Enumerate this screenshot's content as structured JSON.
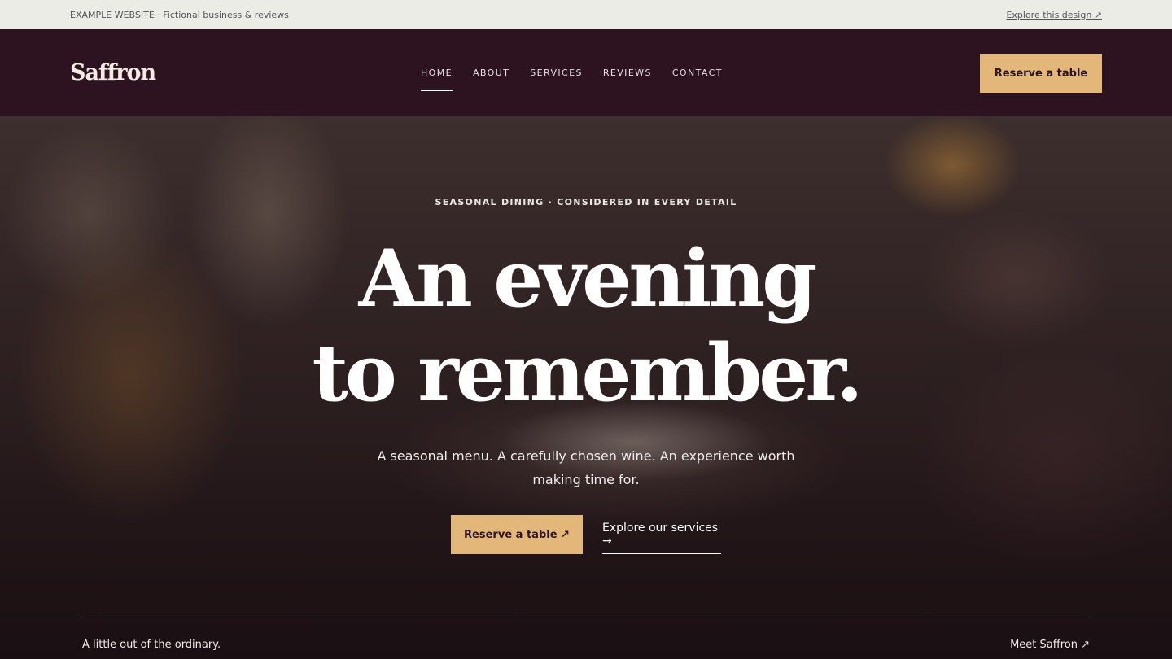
{
  "topbar": {
    "label": "EXAMPLE WEBSITE · Fictional business & reviews",
    "link": "Explore this design ↗"
  },
  "header": {
    "logo": "Saffron",
    "nav": [
      "HOME",
      "ABOUT",
      "SERVICES",
      "REVIEWS",
      "CONTACT"
    ],
    "active_nav": "HOME",
    "cta": "Reserve a table"
  },
  "hero": {
    "eyebrow": "SEASONAL DINING · CONSIDERED IN EVERY DETAIL",
    "headline_line1": "An evening",
    "headline_line2": "to remember.",
    "subtext": "A seasonal menu. A carefully chosen wine. An experience worth making time for.",
    "primary_cta": "Reserve a table ↗",
    "secondary_cta": "Explore our services →",
    "footer_left": "A little out of the ordinary.",
    "footer_right": "Meet Saffron ↗"
  },
  "colors": {
    "header_bg": "#2d1320",
    "accent": "#e3b77a",
    "topbar_bg": "#ecece7"
  }
}
